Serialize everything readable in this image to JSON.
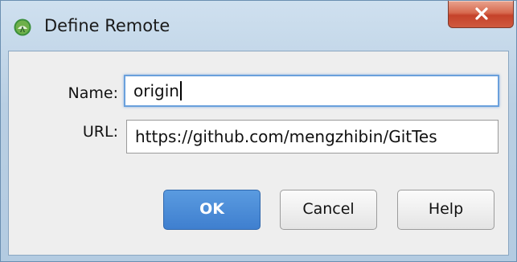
{
  "window": {
    "title": "Define Remote",
    "app_icon": "android-studio-icon",
    "close_icon": "close-x-icon"
  },
  "form": {
    "name_label": "Name:",
    "name_value": "origin",
    "url_label": "URL:",
    "url_value": "https://github.com/mengzhibin/GitTes"
  },
  "buttons": {
    "ok_label": "OK",
    "cancel_label": "Cancel",
    "help_label": "Help"
  },
  "colors": {
    "primary_button": "#3f7fcf",
    "focus_ring": "#6aa0dc",
    "close_button": "#c5422a"
  }
}
